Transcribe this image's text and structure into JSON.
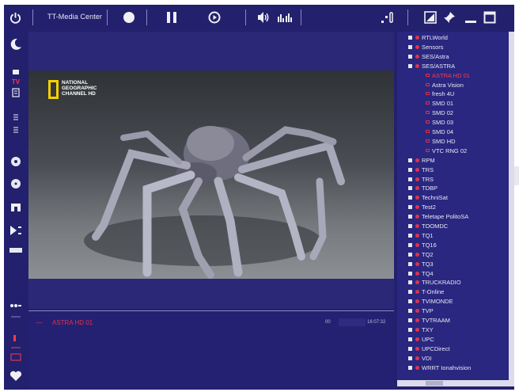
{
  "app": {
    "title": "TT-Media Center"
  },
  "toolbar": {
    "icons": [
      "power-icon",
      "record-icon",
      "pause-icon",
      "play-icon",
      "volume-icon",
      "audio-channel-icon",
      "fullscreen-icon",
      "edit-icon",
      "pin-icon",
      "minimize-icon",
      "maximize-icon"
    ]
  },
  "sidebar": {
    "label_tv": "TV",
    "items": [
      "sleep-icon",
      "tv-icon",
      "list-icon",
      "disc-icon",
      "cd-icon",
      "gamepad-icon",
      "playlist-icon",
      "device-icon",
      "add-icon",
      "record-list-icon",
      "favorites-icon"
    ]
  },
  "video": {
    "logo_text": "NATIONAL GEOGRAPHIC CHANNEL HD"
  },
  "info": {
    "channel": "ASTRA HD 01",
    "counter": "00",
    "time": "16:07:32"
  },
  "channels": [
    {
      "label": "RTLWorld",
      "type": "group"
    },
    {
      "label": "Sensors",
      "type": "group"
    },
    {
      "label": "SES/Astra",
      "type": "group"
    },
    {
      "label": "SES/ASTRA",
      "type": "group"
    },
    {
      "label": "ASTRA HD 01",
      "type": "child",
      "selected": true
    },
    {
      "label": "Astra Vision",
      "type": "child"
    },
    {
      "label": "fresh 4U",
      "type": "child"
    },
    {
      "label": "SMD 01",
      "type": "child"
    },
    {
      "label": "SMD 02",
      "type": "child"
    },
    {
      "label": "SMD 03",
      "type": "child"
    },
    {
      "label": "SMD 04",
      "type": "child"
    },
    {
      "label": "SMD HD",
      "type": "child"
    },
    {
      "label": "VTC RNG 02",
      "type": "child"
    },
    {
      "label": "RPM",
      "type": "group"
    },
    {
      "label": "TRS",
      "type": "group"
    },
    {
      "label": "TRS",
      "type": "group"
    },
    {
      "label": "TDBP",
      "type": "group"
    },
    {
      "label": "TechniSat",
      "type": "group"
    },
    {
      "label": "Test2",
      "type": "group"
    },
    {
      "label": "Teletape PolitoSA",
      "type": "group"
    },
    {
      "label": "TOOMDC",
      "type": "group"
    },
    {
      "label": "TQ1",
      "type": "group"
    },
    {
      "label": "TQ16",
      "type": "group"
    },
    {
      "label": "TQ2",
      "type": "group"
    },
    {
      "label": "TQ3",
      "type": "group"
    },
    {
      "label": "TQ4",
      "type": "group"
    },
    {
      "label": "TRUCKRADIO",
      "type": "group"
    },
    {
      "label": "T-Online",
      "type": "group"
    },
    {
      "label": "TVIMONDE",
      "type": "group"
    },
    {
      "label": "TVP",
      "type": "group"
    },
    {
      "label": "TVTRAAM",
      "type": "group"
    },
    {
      "label": "TXY",
      "type": "group"
    },
    {
      "label": "UPC",
      "type": "group"
    },
    {
      "label": "UPCDirect",
      "type": "group"
    },
    {
      "label": "VDI",
      "type": "group"
    },
    {
      "label": "WRRT Ionahvision",
      "type": "group"
    }
  ],
  "colors": {
    "background": "#23206e",
    "accent": "#e0324a",
    "panel": "#2a2780",
    "logo": "#f5d100"
  }
}
